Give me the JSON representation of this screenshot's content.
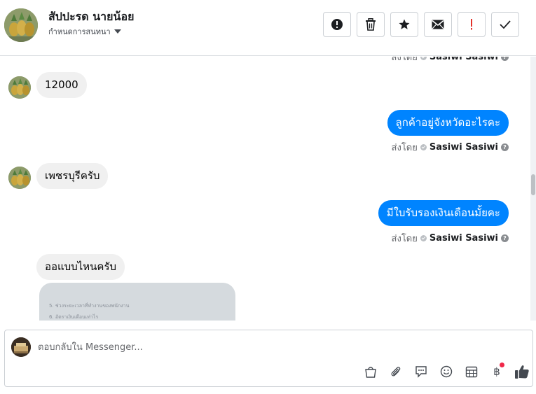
{
  "header": {
    "contact_name": "สัปปะรด นายน้อย",
    "conversation_settings": "กำหนดการสนทนา",
    "actions": [
      {
        "name": "report-icon",
        "label": "report"
      },
      {
        "name": "trash-icon",
        "label": "delete"
      },
      {
        "name": "star-icon",
        "label": "star"
      },
      {
        "name": "envelope-icon",
        "label": "mark unread"
      },
      {
        "name": "exclamation-icon",
        "label": "important"
      },
      {
        "name": "checkmark-icon",
        "label": "done"
      }
    ]
  },
  "chat": {
    "sent_by_label": "ส่งโดย",
    "sender_name": "Sasiwi Sasiwi",
    "help_glyph": "?",
    "messages": [
      {
        "direction": "in",
        "text": "12000"
      },
      {
        "direction": "out",
        "text": "ลูกค้าอยู่จังหวัดอะไรคะ"
      },
      {
        "direction": "in",
        "text": "เพชรบุรีครับ"
      },
      {
        "direction": "out",
        "text": "มีใบรับรองเงินเดือนมั้ยคะ"
      },
      {
        "direction": "in",
        "text": "ออแบบไหนครับ"
      }
    ],
    "image_lines": [
      "5. ช่วงระยะเวลาที่ทำงานของพนักงาน",
      "6. อัตราเงินเดือนเท่าไร"
    ]
  },
  "composer": {
    "placeholder": "ตอบกลับใน Messenger...",
    "tools": [
      "bag-icon",
      "paperclip-icon",
      "speech-bubble-icon",
      "emoji-icon",
      "calendar-icon",
      "baht-icon",
      "thumbs-up-icon"
    ],
    "currency_symbol": "฿"
  },
  "colors": {
    "outgoing_bubble": "#0084ff",
    "incoming_bubble": "#f0f0f0",
    "accent_red": "#e4332b",
    "notification_dot": "#f02849"
  }
}
